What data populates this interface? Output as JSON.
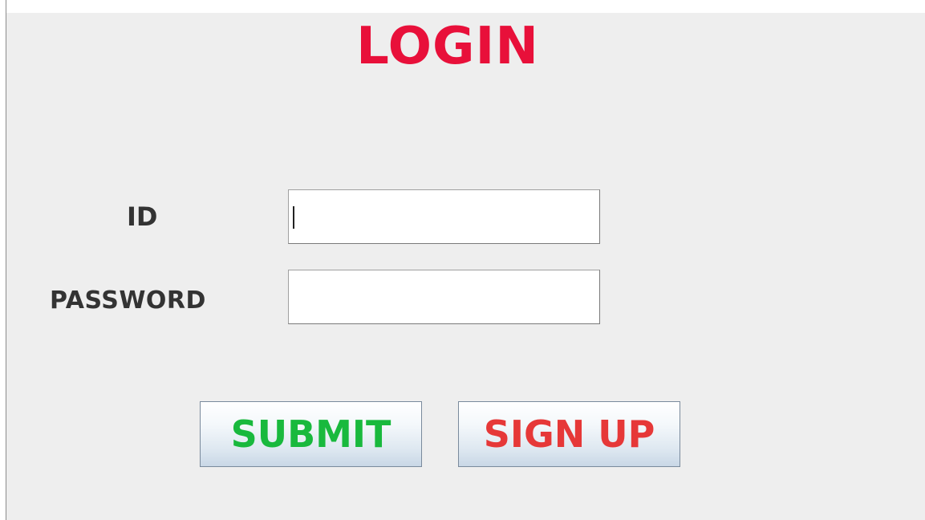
{
  "form": {
    "title": "LOGIN",
    "id_label": "ID",
    "password_label": "PASSWORD",
    "id_value": "",
    "password_value": ""
  },
  "buttons": {
    "submit_label": "SUBMIT",
    "signup_label": "SIGN UP"
  },
  "colors": {
    "title": "#e8103a",
    "submit_text": "#19b93d",
    "signup_text": "#e63838",
    "panel_background": "#eeeeee"
  }
}
